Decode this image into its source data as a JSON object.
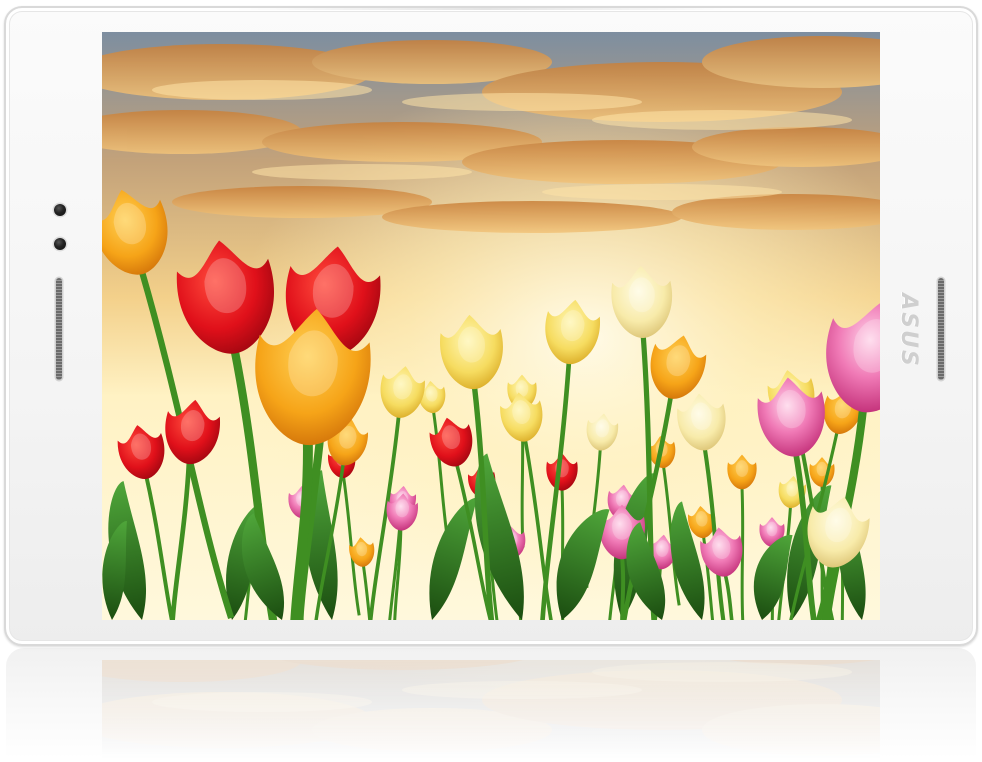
{
  "device": {
    "brand_logo": "ASUS",
    "frame_color": "#f5f5f5"
  },
  "screen": {
    "content": "photo",
    "palette": {
      "sky_top": "#7a8fa3",
      "sky_glow": "#ffe7a8",
      "cloud": "#d8913f",
      "tulip_red": "#e3101a",
      "tulip_orange": "#f6a418",
      "tulip_yellow": "#f6dc60",
      "tulip_cream": "#fbeeb0",
      "tulip_pink": "#e2438e",
      "leaf": "#2f7d1e"
    }
  }
}
